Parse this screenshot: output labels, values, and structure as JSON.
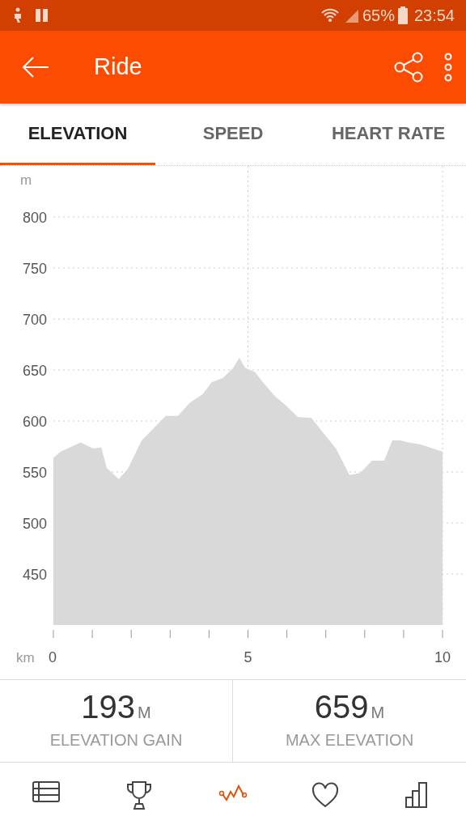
{
  "status_bar": {
    "battery_text": "65%",
    "time": "23:54"
  },
  "app_bar": {
    "title": "Ride"
  },
  "tabs": [
    {
      "label": "ELEVATION",
      "selected": true
    },
    {
      "label": "SPEED",
      "selected": false
    },
    {
      "label": "HEART RATE",
      "selected": false
    }
  ],
  "chart": {
    "chart_data": {
      "type": "area",
      "xlabel": "km",
      "ylabel": "m",
      "x": [
        0,
        0.19,
        0.7,
        1.02,
        1.23,
        1.37,
        1.68,
        1.91,
        2.27,
        2.58,
        2.89,
        3.2,
        3.51,
        3.83,
        4.07,
        4.35,
        4.62,
        4.78,
        4.93,
        5.18,
        5.38,
        5.7,
        5.95,
        6.28,
        6.63,
        6.9,
        7.26,
        7.61,
        7.88,
        8.19,
        8.5,
        8.71,
        8.92,
        9.13,
        9.44,
        9.75,
        10
      ],
      "series": [
        {
          "color": "#d9d9d9",
          "values": [
            564,
            570,
            579,
            573,
            574,
            554,
            543,
            553,
            581,
            593,
            605,
            605,
            618,
            626,
            638,
            642,
            652,
            662,
            652,
            648,
            638,
            624,
            616,
            604,
            603,
            590,
            573,
            547,
            549,
            561,
            561,
            581,
            581,
            579,
            577,
            573,
            570
          ]
        }
      ],
      "xlim": [
        0,
        10
      ],
      "ylim": [
        400,
        800
      ],
      "grid": true,
      "xticks": [
        0,
        5,
        10
      ],
      "yticks": [
        450,
        500,
        550,
        600,
        650,
        700,
        750,
        800
      ]
    }
  },
  "stats": [
    {
      "value": "193",
      "unit": "M",
      "label": "ELEVATION GAIN"
    },
    {
      "value": "659",
      "unit": "M",
      "label": "MAX ELEVATION"
    }
  ],
  "bottom_nav": [
    {
      "kind": "overview",
      "selected": false
    },
    {
      "kind": "achievements",
      "selected": false
    },
    {
      "kind": "analysis",
      "selected": true
    },
    {
      "kind": "kudos",
      "selected": false
    },
    {
      "kind": "stats",
      "selected": false
    }
  ]
}
